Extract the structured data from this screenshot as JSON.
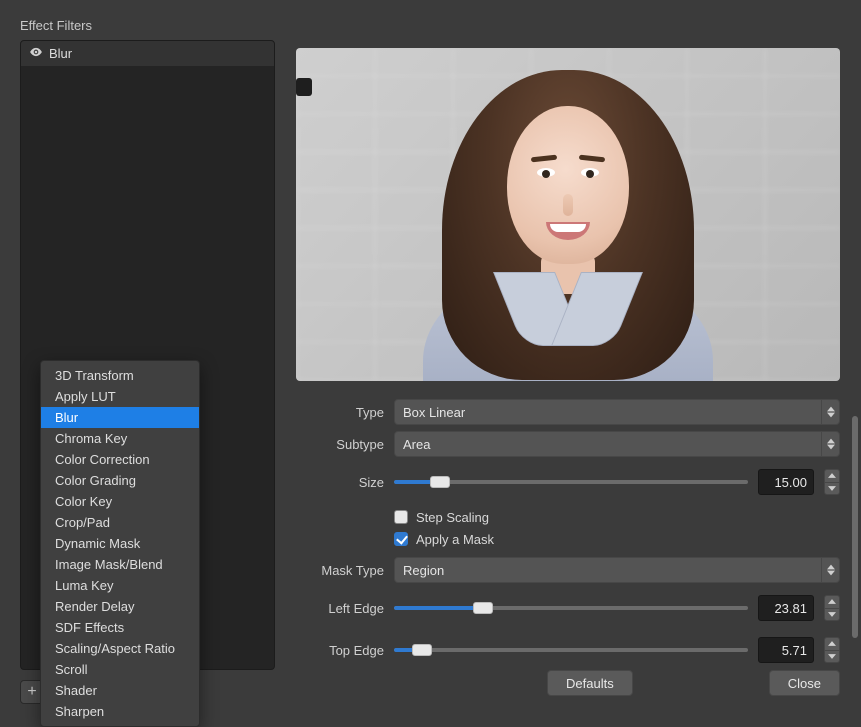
{
  "panel_title": "Effect Filters",
  "applied_filters": [
    {
      "label": "Blur"
    }
  ],
  "context_menu": {
    "items": [
      "3D Transform",
      "Apply LUT",
      "Blur",
      "Chroma Key",
      "Color Correction",
      "Color Grading",
      "Color Key",
      "Crop/Pad",
      "Dynamic Mask",
      "Image Mask/Blend",
      "Luma Key",
      "Render Delay",
      "SDF Effects",
      "Scaling/Aspect Ratio",
      "Scroll",
      "Shader",
      "Sharpen"
    ],
    "selected_index": 2
  },
  "settings": {
    "type": {
      "label": "Type",
      "value": "Box Linear"
    },
    "subtype": {
      "label": "Subtype",
      "value": "Area"
    },
    "size": {
      "label": "Size",
      "value": "15.00",
      "percent": 13
    },
    "step_scaling": {
      "label": "Step Scaling",
      "checked": false
    },
    "apply_mask": {
      "label": "Apply a Mask",
      "checked": true
    },
    "mask_type": {
      "label": "Mask Type",
      "value": "Region"
    },
    "left_edge": {
      "label": "Left Edge",
      "value": "23.81",
      "percent": 25
    },
    "top_edge": {
      "label": "Top Edge",
      "value": "5.71",
      "percent": 8
    }
  },
  "buttons": {
    "defaults": "Defaults",
    "close": "Close"
  },
  "colors": {
    "accent": "#2f7ad1",
    "bg": "#3b3b3b",
    "panel": "#242424",
    "menu": "#404040"
  }
}
